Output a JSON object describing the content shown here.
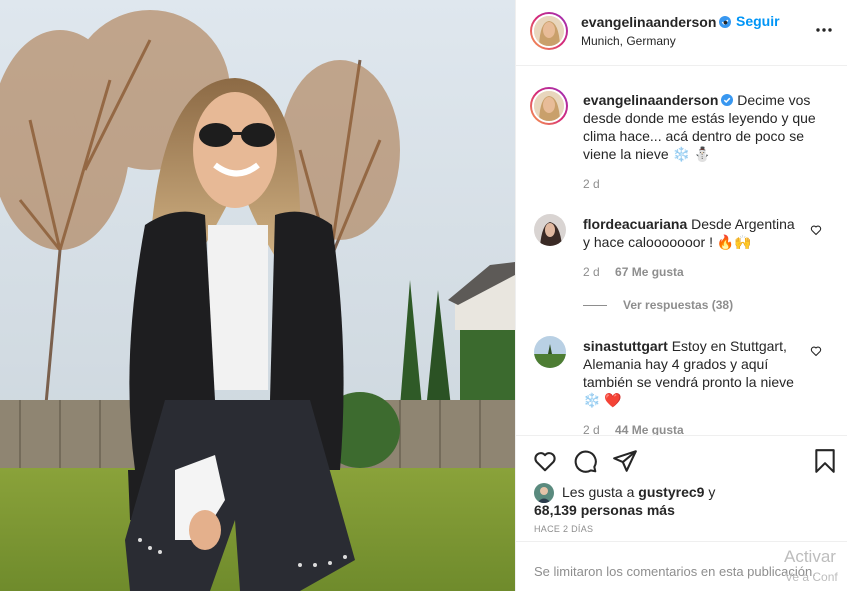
{
  "post": {
    "author": "evangelinaanderson",
    "follow_label": "Seguir",
    "separator": "•",
    "location": "Munich, Germany",
    "verified": true
  },
  "icons": {
    "more": "more-options-icon",
    "like": "heart-icon",
    "comment": "comment-icon",
    "share": "share-icon",
    "save": "bookmark-icon"
  },
  "caption": {
    "username": "evangelinaanderson",
    "text": "Decime vos desde donde me estás leyendo y que clima hace... acá dentro de poco se viene la nieve ❄️ ⛄",
    "time": "2 d"
  },
  "comments": [
    {
      "username": "flordeacuariana",
      "text": "Desde Argentina y hace calooooooor ! 🔥🙌",
      "time": "2 d",
      "likes": "67 Me gusta",
      "replies": "Ver respuestas (38)"
    },
    {
      "username": "sinastuttgart",
      "text": "Estoy en Stuttgart, Alemania hay 4 grados y aquí también se vendrá pronto la nieve ❄️ ❤️",
      "time": "2 d",
      "likes": "44 Me gusta"
    }
  ],
  "likes": {
    "prefix": "Les gusta a",
    "user": "gustyrec9",
    "connector": "y",
    "count": "68,139 personas más"
  },
  "posted_ago": "HACE 2 DÍAS",
  "comments_disabled": "Se limitaron los comentarios en esta publicación.",
  "watermark": {
    "line1": "Activar",
    "line2": "Ve a Conf"
  },
  "colors": {
    "accent": "#0095f6",
    "text": "#262626",
    "muted": "#8e8e8e",
    "border": "#efefef"
  }
}
